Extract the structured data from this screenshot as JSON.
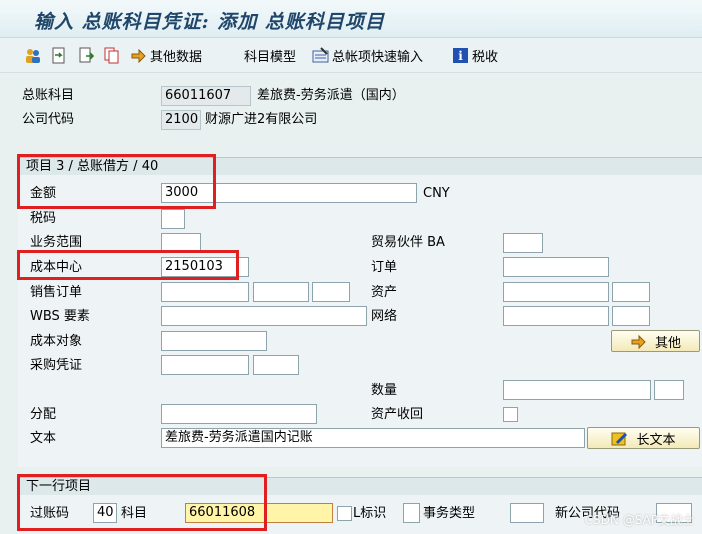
{
  "title": "输入 总账科目凭证: 添加 总账科目项目",
  "toolbar": {
    "other_data": "其他数据",
    "account_model": "科目模型",
    "gl_fast_entry": "总帐项快速输入",
    "tax": "税收"
  },
  "header": {
    "gl_account_label": "总账科目",
    "gl_account_value": "66011607",
    "gl_account_desc": "差旅费-劳务派遣（国内）",
    "company_code_label": "公司代码",
    "company_code_value": "2100",
    "company_name": "财源广进2有限公司"
  },
  "item_section": {
    "heading": "项目 3 / 总账借方 / 40",
    "amount_label": "金额",
    "amount_value": "3000",
    "currency": "CNY",
    "tax_code_label": "税码",
    "business_area_label": "业务范围",
    "trading_partner_label": "贸易伙伴 BA",
    "cost_center_label": "成本中心",
    "cost_center_value": "2150103",
    "order_label": "订单",
    "sales_order_label": "销售订单",
    "asset_label": "资产",
    "wbs_label": "WBS 要素",
    "network_label": "网络",
    "cost_object_label": "成本对象",
    "more_button": "其他",
    "purchasing_doc_label": "采购凭证",
    "quantity_label": "数量",
    "assignment_label": "分配",
    "asset_retirement_label": "资产收回",
    "text_label": "文本",
    "text_value": "差旅费-劳务派遣国内记账",
    "long_text_button": "长文本"
  },
  "next_line": {
    "heading": "下一行项目",
    "posting_key_label": "过账码",
    "posting_key_value": "40",
    "account_label": "科目",
    "account_value": "66011608",
    "sgl_label": "L标识",
    "transaction_type_label": "事务类型",
    "new_company_code_label": "新公司代码"
  },
  "watermark": "CSDN @SAP文战士"
}
